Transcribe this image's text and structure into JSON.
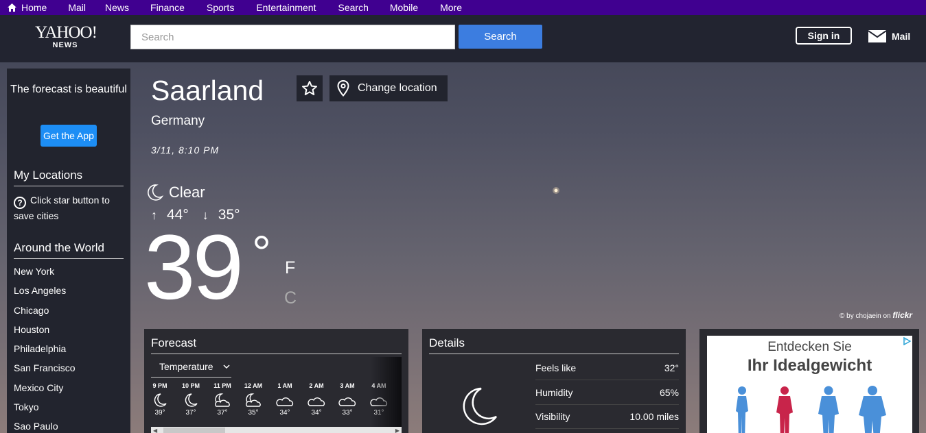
{
  "nav": [
    {
      "label": "Home",
      "icon": "home-icon"
    },
    {
      "label": "Mail"
    },
    {
      "label": "News"
    },
    {
      "label": "Finance"
    },
    {
      "label": "Sports"
    },
    {
      "label": "Entertainment"
    },
    {
      "label": "Search"
    },
    {
      "label": "Mobile"
    },
    {
      "label": "More"
    }
  ],
  "header": {
    "logo_line1": "YAHOO!",
    "logo_line2": "NEWS",
    "search_placeholder": "Search",
    "search_button": "Search",
    "signin": "Sign in",
    "mail": "Mail"
  },
  "sidebar": {
    "promo_text": "The forecast is beautiful",
    "get_app": "Get the App",
    "my_locations": "My Locations",
    "hint_icon": "?",
    "hint": "Click star button to save cities",
    "around_world": "Around the World",
    "cities": [
      "New York",
      "Los Angeles",
      "Chicago",
      "Houston",
      "Philadelphia",
      "San Francisco",
      "Mexico City",
      "Tokyo",
      "Sao Paulo"
    ]
  },
  "weather": {
    "location": "Saarland",
    "country": "Germany",
    "change_location": "Change location",
    "datetime": "3/11, 8:10 PM",
    "condition": "Clear",
    "high": "44°",
    "low": "35°",
    "high_arrow": "↑",
    "low_arrow": "↓",
    "temp": "39",
    "degree": "°",
    "unit_f": "F",
    "unit_c": "C"
  },
  "photo_credit": {
    "by": "© by chojaein on",
    "site": "flickr"
  },
  "forecast": {
    "title": "Forecast",
    "selector": "Temperature",
    "hours": [
      {
        "time": "9 PM",
        "icon": "moon-icon",
        "temp": "39°"
      },
      {
        "time": "10 PM",
        "icon": "moon-icon",
        "temp": "37°"
      },
      {
        "time": "11 PM",
        "icon": "moon-cloud-icon",
        "temp": "37°"
      },
      {
        "time": "12 AM",
        "icon": "moon-cloud-icon",
        "temp": "35°"
      },
      {
        "time": "1 AM",
        "icon": "cloud-icon",
        "temp": "34°"
      },
      {
        "time": "2 AM",
        "icon": "cloud-icon",
        "temp": "34°"
      },
      {
        "time": "3 AM",
        "icon": "cloud-icon",
        "temp": "33°"
      },
      {
        "time": "4 AM",
        "icon": "cloud-icon",
        "temp": "31°"
      }
    ]
  },
  "details": {
    "title": "Details",
    "rows": [
      {
        "label": "Feels like",
        "value": "32°"
      },
      {
        "label": "Humidity",
        "value": "65%"
      },
      {
        "label": "Visibility",
        "value": "10.00 miles"
      }
    ]
  },
  "ad": {
    "line1": "Entdecken Sie",
    "line2": "Ihr Idealgewicht"
  },
  "colors": {
    "nav_bg": "#400090",
    "header_bg": "#222430",
    "accent": "#3c7de0",
    "app_btn": "#1d8ef5"
  }
}
